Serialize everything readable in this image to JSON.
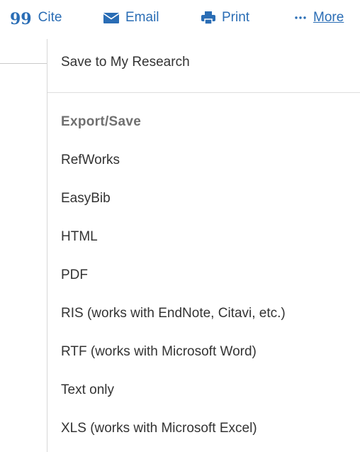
{
  "toolbar": {
    "cite": {
      "label": "Cite",
      "icon": "quote-icon"
    },
    "email": {
      "label": "Email",
      "icon": "envelope-icon"
    },
    "print": {
      "label": "Print",
      "icon": "printer-icon"
    },
    "more": {
      "label": "More",
      "icon": "ellipsis-icon"
    }
  },
  "menu": {
    "save_label": "Save to My Research",
    "export_heading": "Export/Save",
    "export_items": [
      "RefWorks",
      "EasyBib",
      "HTML",
      "PDF",
      "RIS (works with EndNote, Citavi, etc.)",
      "RTF (works with Microsoft Word)",
      "Text only",
      "XLS (works with Microsoft Excel)"
    ]
  },
  "colors": {
    "link": "#2a6db5",
    "text": "#333333",
    "heading": "#6f6f6f",
    "divider": "#dedede"
  }
}
